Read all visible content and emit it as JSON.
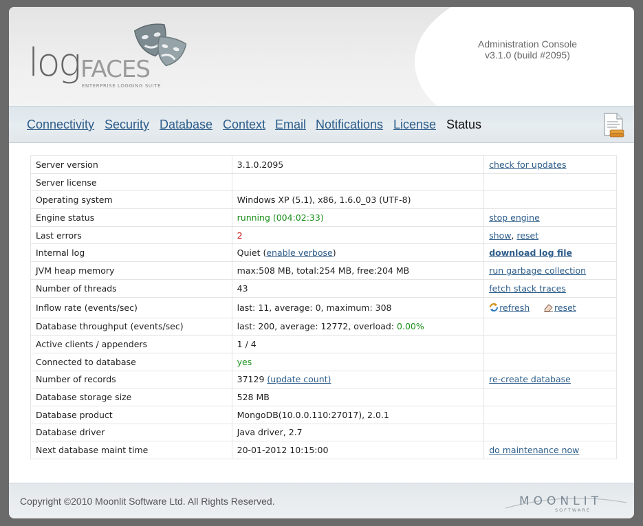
{
  "header": {
    "console_title": "Administration Console",
    "version": "v3.1.0 (build #2095)",
    "logo_text_main": "log",
    "logo_text_second": "FACES",
    "logo_tagline": "ENTERPRISE LOGGING SUITE"
  },
  "nav": {
    "items": [
      {
        "label": "Connectivity"
      },
      {
        "label": "Security"
      },
      {
        "label": "Database"
      },
      {
        "label": "Context"
      },
      {
        "label": "Email"
      },
      {
        "label": "Notifications"
      },
      {
        "label": "License"
      },
      {
        "label": "Status"
      }
    ],
    "active": "Status"
  },
  "status": {
    "server_version": {
      "label": "Server version",
      "value": "3.1.0.2095",
      "action": "check for updates"
    },
    "server_license": {
      "label": "Server license",
      "value": ""
    },
    "operating_system": {
      "label": "Operating system",
      "value": "Windows XP (5.1), x86, 1.6.0_03 (UTF-8)"
    },
    "engine_status": {
      "label": "Engine status",
      "value": "running (004:02:33)",
      "action": "stop engine"
    },
    "last_errors": {
      "label": "Last errors",
      "value": "2",
      "action_show": "show",
      "separator": ",",
      "action_reset": "reset"
    },
    "internal_log": {
      "label": "Internal log",
      "value_prefix": "Quiet (",
      "value_link": "enable verbose",
      "value_suffix": ")",
      "action": "download log file"
    },
    "jvm_heap": {
      "label": "JVM heap memory",
      "value": "max:508 MB, total:254 MB, free:204 MB",
      "action": "run garbage collection"
    },
    "threads": {
      "label": "Number of threads",
      "value": "43",
      "action": "fetch stack traces"
    },
    "inflow_rate": {
      "label": "Inflow rate (events/sec)",
      "value": "last: 11, average: 0, maximum: 308",
      "action_refresh": "refresh",
      "action_reset": "reset"
    },
    "db_throughput": {
      "label": "Database throughput (events/sec)",
      "value_prefix": "last: 200, average: 12772, overload: ",
      "value_overload": "0.00%"
    },
    "active_clients": {
      "label": "Active clients / appenders",
      "value": "1 / 4"
    },
    "connected_db": {
      "label": "Connected to database",
      "value": "yes"
    },
    "num_records": {
      "label": "Number of records",
      "value": "37129",
      "value_link": "(update count)",
      "action": "re-create database"
    },
    "db_storage": {
      "label": "Database storage size",
      "value": "528 MB"
    },
    "db_product": {
      "label": "Database product",
      "value": "MongoDB(10.0.0.110:27017), 2.0.1"
    },
    "db_driver": {
      "label": "Database driver",
      "value": "Java driver, 2.7"
    },
    "next_maint": {
      "label": "Next database maint time",
      "value": "20-01-2012 10:15:00",
      "action": "do maintenance now"
    }
  },
  "footer": {
    "copyright": "Copyright ©2010 Moonlit Software Ltd. All Rights Reserved.",
    "company_name": "MOONLIT",
    "company_sub": "SOFTWARE"
  },
  "colors": {
    "link": "#2d5d8a",
    "ok_green": "#1a8f1a",
    "error_red": "#cc1010"
  },
  "icons": [
    "theatre-masks-icon",
    "report-icon",
    "refresh-icon",
    "eraser-icon"
  ]
}
